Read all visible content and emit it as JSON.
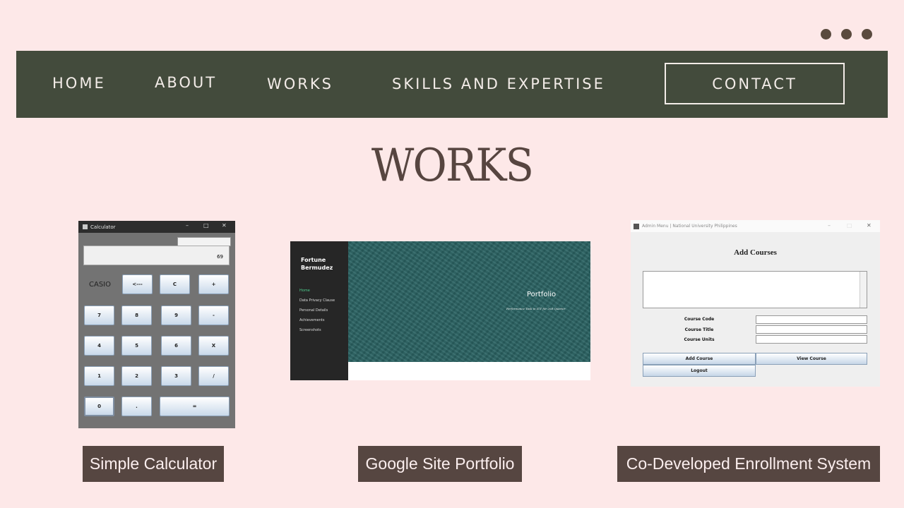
{
  "nav": {
    "home": "HOME",
    "about": "ABOUT",
    "works": "WORKS",
    "skills": "SKILLS AND EXPERTISE",
    "contact": "CONTACT"
  },
  "heading": "WORKS",
  "projects": [
    {
      "caption": "Simple Calculator"
    },
    {
      "caption": "Google Site Portfolio"
    },
    {
      "caption": "Co-Developed Enrollment System"
    }
  ],
  "calculator": {
    "window_title": "Calculator",
    "display_value": "69",
    "brand": "CASIO",
    "buttons": [
      "<---",
      "C",
      "+",
      "7",
      "8",
      "9",
      "-",
      "4",
      "5",
      "6",
      "X",
      "1",
      "2",
      "3",
      "/",
      "0",
      ".",
      "="
    ]
  },
  "google_site": {
    "name": "Fortune Bermudez",
    "links": [
      "Home",
      "Data Privacy Clause",
      "Personal Details",
      "Achievements",
      "Screenshots"
    ],
    "hero_title": "Portfolio",
    "hero_subtitle": "Performance Task in ICT for 2nd Quarter",
    "active_link_color": "#4ecf8e",
    "hero_color": "#2a6262"
  },
  "admin": {
    "window_title": "Admin Menu | National University Philippines",
    "heading": "Add Courses",
    "fields": [
      "Course Code",
      "Course Title",
      "Course Units"
    ],
    "buttons": {
      "add": "Add Course",
      "view": "View Course",
      "logout": "Logout"
    }
  },
  "colors": {
    "background": "#fde8e8",
    "nav_bg": "#434b3c",
    "caption_bg": "#564641",
    "heading": "#574540"
  }
}
